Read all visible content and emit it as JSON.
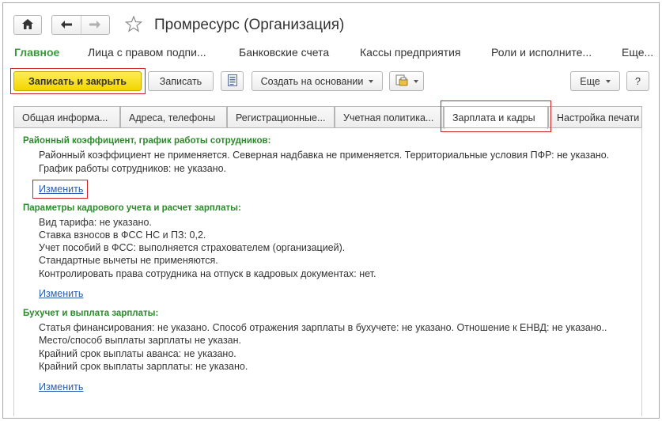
{
  "window": {
    "title": "Промресурс (Организация)",
    "home_icon": "home-icon",
    "back_icon": "arrow-left-icon",
    "forward_icon": "arrow-right-icon",
    "favorite_icon": "star-icon"
  },
  "nav": {
    "items": [
      {
        "label": "Главное",
        "active": true
      },
      {
        "label": "Лица с правом подпи..."
      },
      {
        "label": "Банковские счета"
      },
      {
        "label": "Кассы предприятия"
      },
      {
        "label": "Роли и исполните..."
      },
      {
        "label": "Еще..."
      }
    ]
  },
  "toolbar": {
    "save_close_label": "Записать и закрыть",
    "save_label": "Записать",
    "create_based_label": "Создать на основании",
    "more_label": "Еще",
    "help_label": "?"
  },
  "tabs": [
    {
      "label": "Общая информа..."
    },
    {
      "label": "Адреса, телефоны"
    },
    {
      "label": "Регистрационные..."
    },
    {
      "label": "Учетная политика..."
    },
    {
      "label": "Зарплата и кадры",
      "active": true
    },
    {
      "label": "Настройка печати"
    }
  ],
  "groups": {
    "regional": {
      "title": "Районный коэффициент, график работы сотрудников:",
      "lines": [
        "Районный коэффициент не применяется. Северная надбавка не применяется. Территориальные условия ПФР: не указано.",
        "График работы сотрудников: не указано."
      ],
      "link": "Изменить"
    },
    "hr": {
      "title": "Параметры кадрового учета и расчет зарплаты:",
      "lines": [
        "Вид тарифа: не указано.",
        " Ставка взносов в ФСС НС и ПЗ: 0,2.",
        "Учет пособий в ФСС: выполняется страхователем (организацией).",
        "Стандартные вычеты не применяются.",
        "Контролировать права сотрудника на отпуск в кадровых документах: нет."
      ],
      "link": "Изменить"
    },
    "accounting": {
      "title": "Бухучет и выплата зарплаты:",
      "lines": [
        "Статья финансирования: не указано. Способ отражения зарплаты в бухучете: не указано. Отношение к ЕНВД: не указано..",
        "Место/способ выплаты зарплаты не указан.",
        "Крайний срок выплаты аванса: не указано.",
        "Крайний срок выплаты зарплаты: не указано."
      ],
      "link": "Изменить"
    }
  },
  "colors": {
    "accent_green": "#2b8a2b",
    "default_button": "#f7e01c",
    "link_blue": "#2a5db0",
    "highlight_red": "#cc2222"
  }
}
